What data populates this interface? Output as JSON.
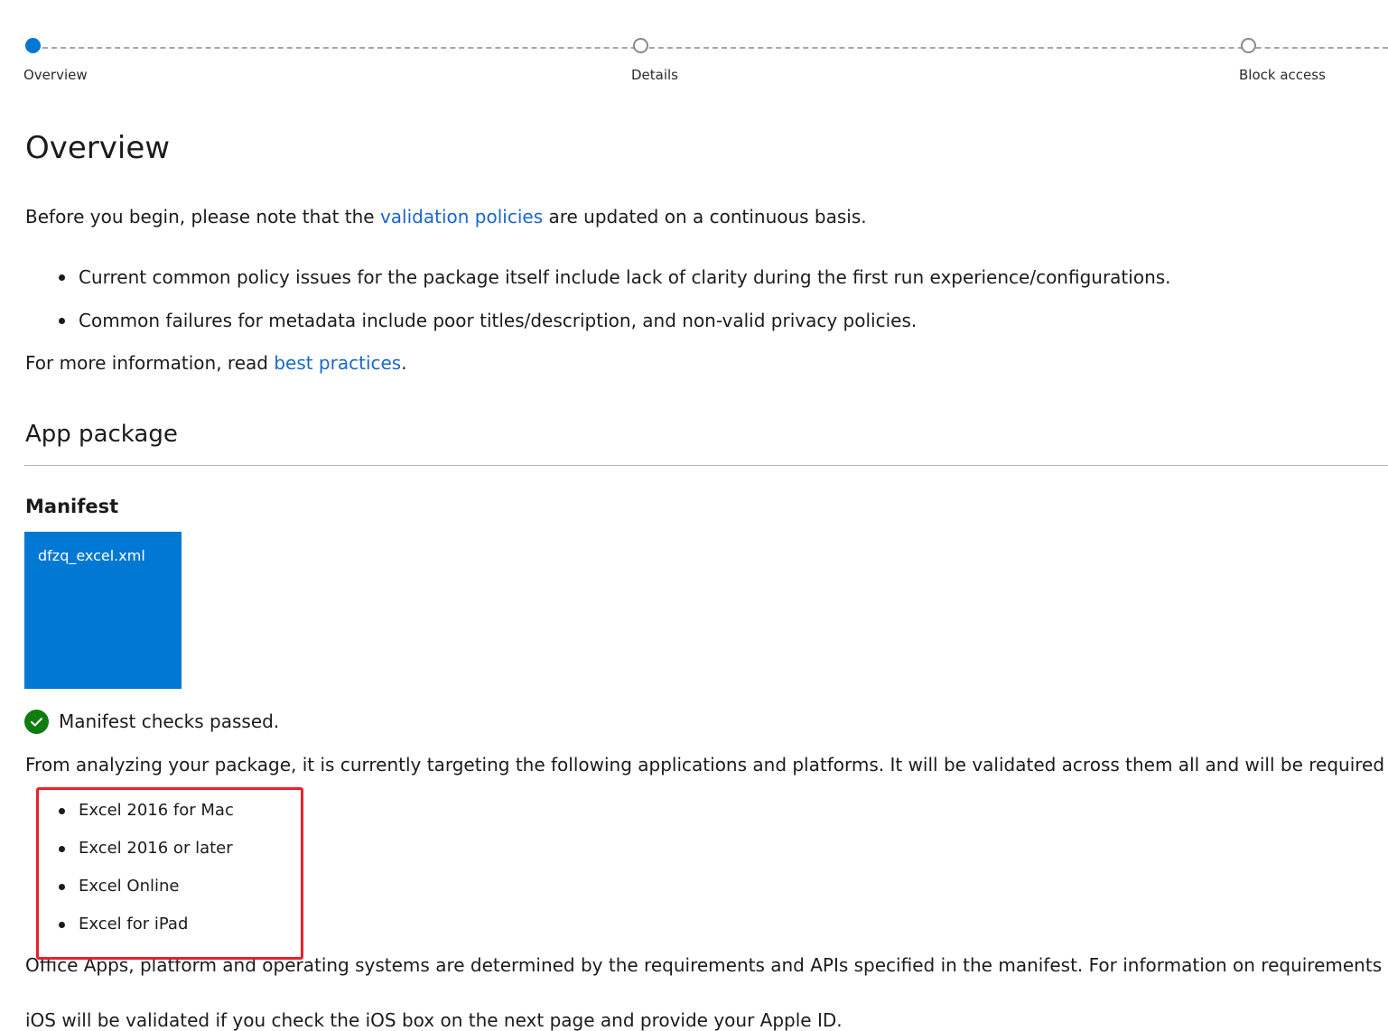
{
  "stepper": {
    "steps": [
      {
        "label": "Overview",
        "state": "current"
      },
      {
        "label": "Details",
        "state": "upcoming"
      },
      {
        "label": "Block access",
        "state": "upcoming"
      }
    ]
  },
  "overview": {
    "title": "Overview",
    "intro": {
      "before": "Before you begin, please note that the ",
      "link": "validation policies",
      "after": " are updated on a continuous basis."
    },
    "issues": [
      "Current common policy issues for the package itself include lack of clarity during the first run experience/configurations.",
      "Common failures for metadata include poor titles/description, and non-valid privacy policies."
    ],
    "more_info": {
      "before": "For more information, read ",
      "link": "best practices",
      "after": "."
    }
  },
  "app_package": {
    "title": "App package",
    "manifest_label": "Manifest",
    "manifest_file": "dfzq_excel.xml",
    "check_status": "Manifest checks passed.",
    "targeting_text": "From analyzing your package, it is currently targeting the following applications and platforms. It will be validated across them all and will be required to",
    "applications": [
      "Excel 2016 for Mac",
      "Excel 2016 or later",
      "Excel Online",
      "Excel for iPad"
    ],
    "requirements_text": "Office Apps, platform and operating systems are determined by the requirements and APIs specified in the manifest. For information on requirements su",
    "ios_text": "iOS will be validated if you check the iOS box on the next page and provide your Apple ID."
  },
  "colors": {
    "accent": "#0078d4",
    "link": "#1a67c8",
    "success": "#107c10",
    "highlight": "#e8202a"
  },
  "icons": {
    "check": "check-circle-icon"
  }
}
